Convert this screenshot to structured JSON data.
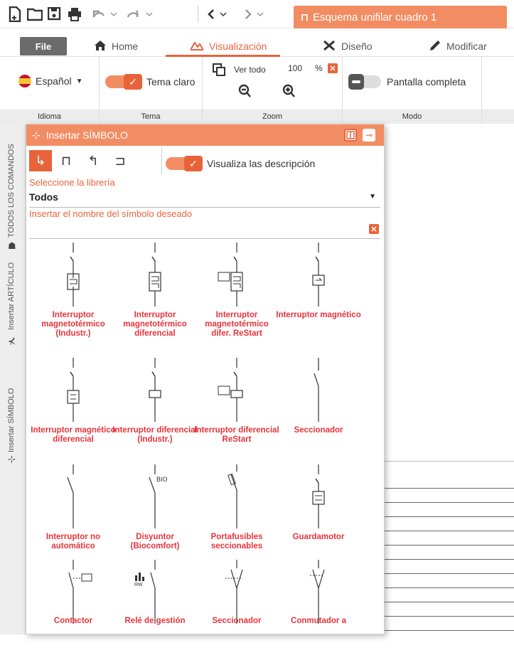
{
  "app": {
    "document_tab": "Esquema unifilar cuadro 1",
    "accent": "#e8633a"
  },
  "quick_access": {
    "icons": [
      "new-document-icon",
      "open-folder-icon",
      "save-icon",
      "print-icon",
      "undo-icon",
      "redo-icon",
      "back-icon",
      "forward-icon"
    ]
  },
  "menubar": {
    "file_label": "File",
    "tabs": [
      {
        "label": "Home",
        "icon": "home-icon"
      },
      {
        "label": "Visualización",
        "icon": "visualization-icon",
        "active": true
      },
      {
        "label": "Diseño",
        "icon": "design-tools-icon"
      },
      {
        "label": "Modificar",
        "icon": "pencil-icon"
      }
    ]
  },
  "ribbon": {
    "idioma": {
      "value": "Español",
      "group_label": "Idioma"
    },
    "tema": {
      "toggle_label": "Tema claro",
      "on": true,
      "group_label": "Tema"
    },
    "zoom": {
      "fit_label": "Ver todo",
      "zoom_value": "100",
      "zoom_unit": "%",
      "group_label": "Zoom"
    },
    "modo": {
      "toggle_label": "Pantalla completa",
      "on": false,
      "group_label": "Modo"
    }
  },
  "side_tabs": {
    "all_commands": "TODOS LOS COMANDOS",
    "insert_article": "Insertar ARTÍCULO",
    "insert_symbol": "Insertar SÍMBOLO"
  },
  "panel": {
    "title": "Insertar SÍMBOLO",
    "show_descriptions_label": "Visualiza las descripción",
    "show_descriptions_on": true,
    "library_label": "Seleccione la librería",
    "library_value": "Todos",
    "search_label": "Insertar el nombre del símbolo deseado",
    "search_value": "",
    "symbols": [
      {
        "name": "Interruptor magnetotérmico (Industr.)"
      },
      {
        "name": "Interruptor magnetotérmico diferencial"
      },
      {
        "name": "Interruptor magnetotérmico difer. ReStart"
      },
      {
        "name": "Interruptor magnético"
      },
      {
        "name": "Interruptor magnético diferencial"
      },
      {
        "name": "Interruptor diferencial (Industr.)"
      },
      {
        "name": "Interruptor diferencial ReStart"
      },
      {
        "name": "Seccionador"
      },
      {
        "name": "Interruptor no automático"
      },
      {
        "name": "Disyuntor (Biocomfort)",
        "symbol_text": "BIO"
      },
      {
        "name": "Portafusibles seccionables"
      },
      {
        "name": "Guardamotor"
      },
      {
        "name": "Contactor"
      },
      {
        "name": "Relé de gestión",
        "symbol_text": "RW"
      },
      {
        "name": "Seccionador"
      },
      {
        "name": "Conmutador a"
      }
    ]
  }
}
